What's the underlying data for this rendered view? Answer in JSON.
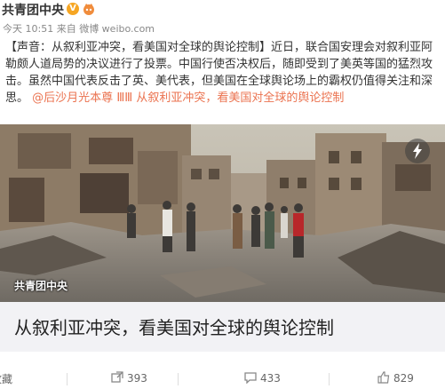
{
  "post": {
    "author": "共青团中央",
    "verified_badge": "V",
    "meta": "今天 10:51 来自 微博 weibo.com",
    "content": {
      "part1": "【声音：从叙利亚冲突，看美国对全球的舆论控制】近日，联合国安理会对叙利亚阿勒颇人道局势的决议进行了投票。中国行使否决权后，随即受到了美英等国的猛烈攻击。虽然中国代表反击了英、美代表，但美国在全球舆论场上的霸权仍值得关注和深思。",
      "mention": "@后沙月光本尊",
      "topic": "ⅢⅢ 从叙利亚冲突，看美国对全球的舆论控制"
    }
  },
  "card": {
    "watermark": "共青团中央",
    "caption": "从叙利亚冲突，看美国对全球的舆论控制"
  },
  "actions": {
    "favorite_label": "收藏",
    "repost_count": "393",
    "comment_count": "433",
    "like_count": "829"
  },
  "colors": {
    "accent": "#eb7350",
    "badge": "#f6a623"
  }
}
